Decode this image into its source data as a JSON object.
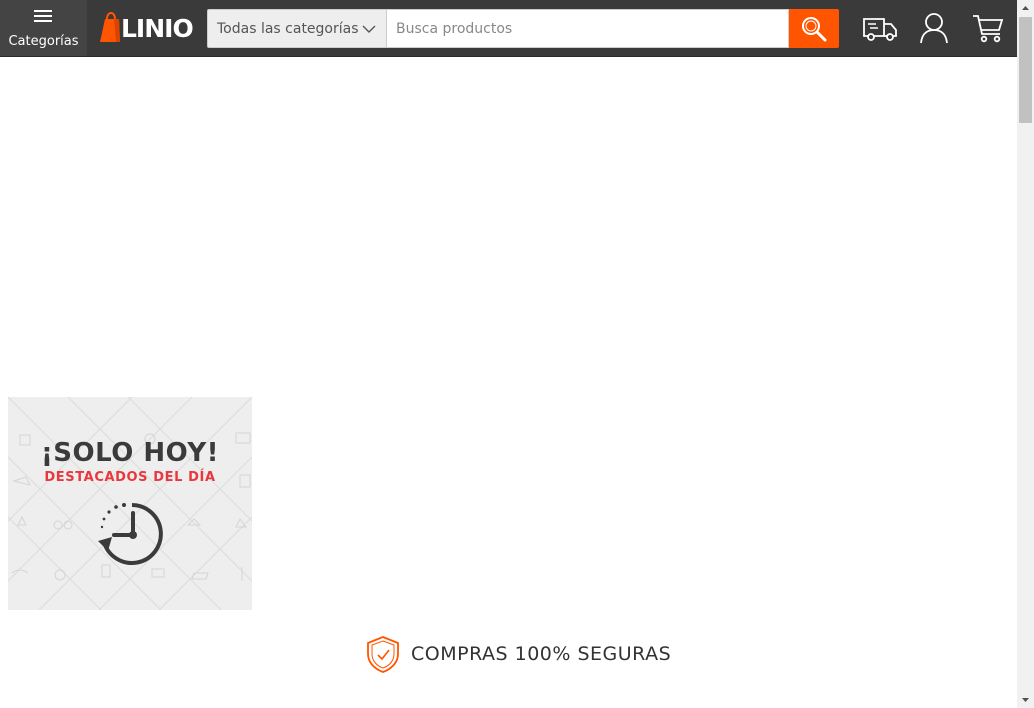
{
  "header": {
    "categories_button_label": "Categorías",
    "logo_text": "LINIO",
    "category_select_value": "Todas las categorías",
    "search_placeholder": "Busca productos",
    "search_value": ""
  },
  "promo": {
    "title": "¡SOLO HOY!",
    "subtitle": "DESTACADOS DEL DÍA"
  },
  "secure": {
    "label": "COMPRAS 100% SEGURAS"
  },
  "colors": {
    "header_bg": "#3a3a3a",
    "brand_orange": "#ff5500",
    "promo_red": "#e8383d"
  },
  "icons": [
    "menu-icon",
    "chevron-down-icon",
    "search-icon",
    "delivery-truck-icon",
    "user-icon",
    "cart-icon",
    "clock-icon",
    "shield-check-icon"
  ]
}
